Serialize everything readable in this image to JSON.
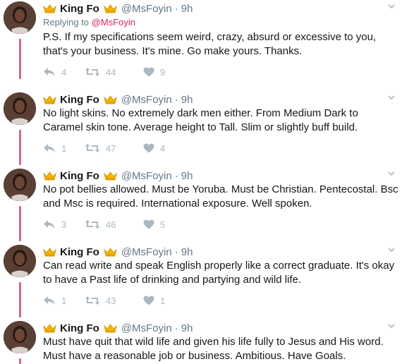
{
  "colors": {
    "accent": "#e0245e",
    "thread_line": "#cc6a8c",
    "muted": "#657786",
    "action_icon": "#aab8c2"
  },
  "tweets": [
    {
      "name": "King Fo",
      "handle": "@MsFoyin",
      "separator": "·",
      "time": "9h",
      "replying_prefix": "Replying to",
      "replying_handle": "@MsFoyin",
      "text": "P.S. If my specifications seem weird, crazy, absurd or excessive to you, that's your business. It's mine. Go make yours. Thanks.",
      "replies": "4",
      "retweets": "44",
      "likes": "9"
    },
    {
      "name": "King Fo",
      "handle": "@MsFoyin",
      "separator": "·",
      "time": "9h",
      "text": "No light skins. No extremely dark men either. From Medium Dark to Caramel skin tone. Average height to Tall. Slim or slightly buff build.",
      "replies": "1",
      "retweets": "47",
      "likes": "4"
    },
    {
      "name": "King Fo",
      "handle": "@MsFoyin",
      "separator": "·",
      "time": "9h",
      "text": "No pot bellies allowed. Must be Yoruba. Must be Christian. Pentecostal. Bsc and Msc is required. International exposure. Well spoken.",
      "replies": "3",
      "retweets": "46",
      "likes": "5"
    },
    {
      "name": "King Fo",
      "handle": "@MsFoyin",
      "separator": "·",
      "time": "9h",
      "text": "Can read write and speak English properly like a correct graduate. It's okay to have a Past life of drinking and partying and wild life.",
      "replies": "1",
      "retweets": "43",
      "likes": "1"
    },
    {
      "name": "King Fo",
      "handle": "@MsFoyin",
      "separator": "·",
      "time": "9h",
      "text": "Must have quit that wild life and given his life fully to Jesus and His word. Must have a reasonable job or business. Ambitious. Have Goals."
    }
  ]
}
